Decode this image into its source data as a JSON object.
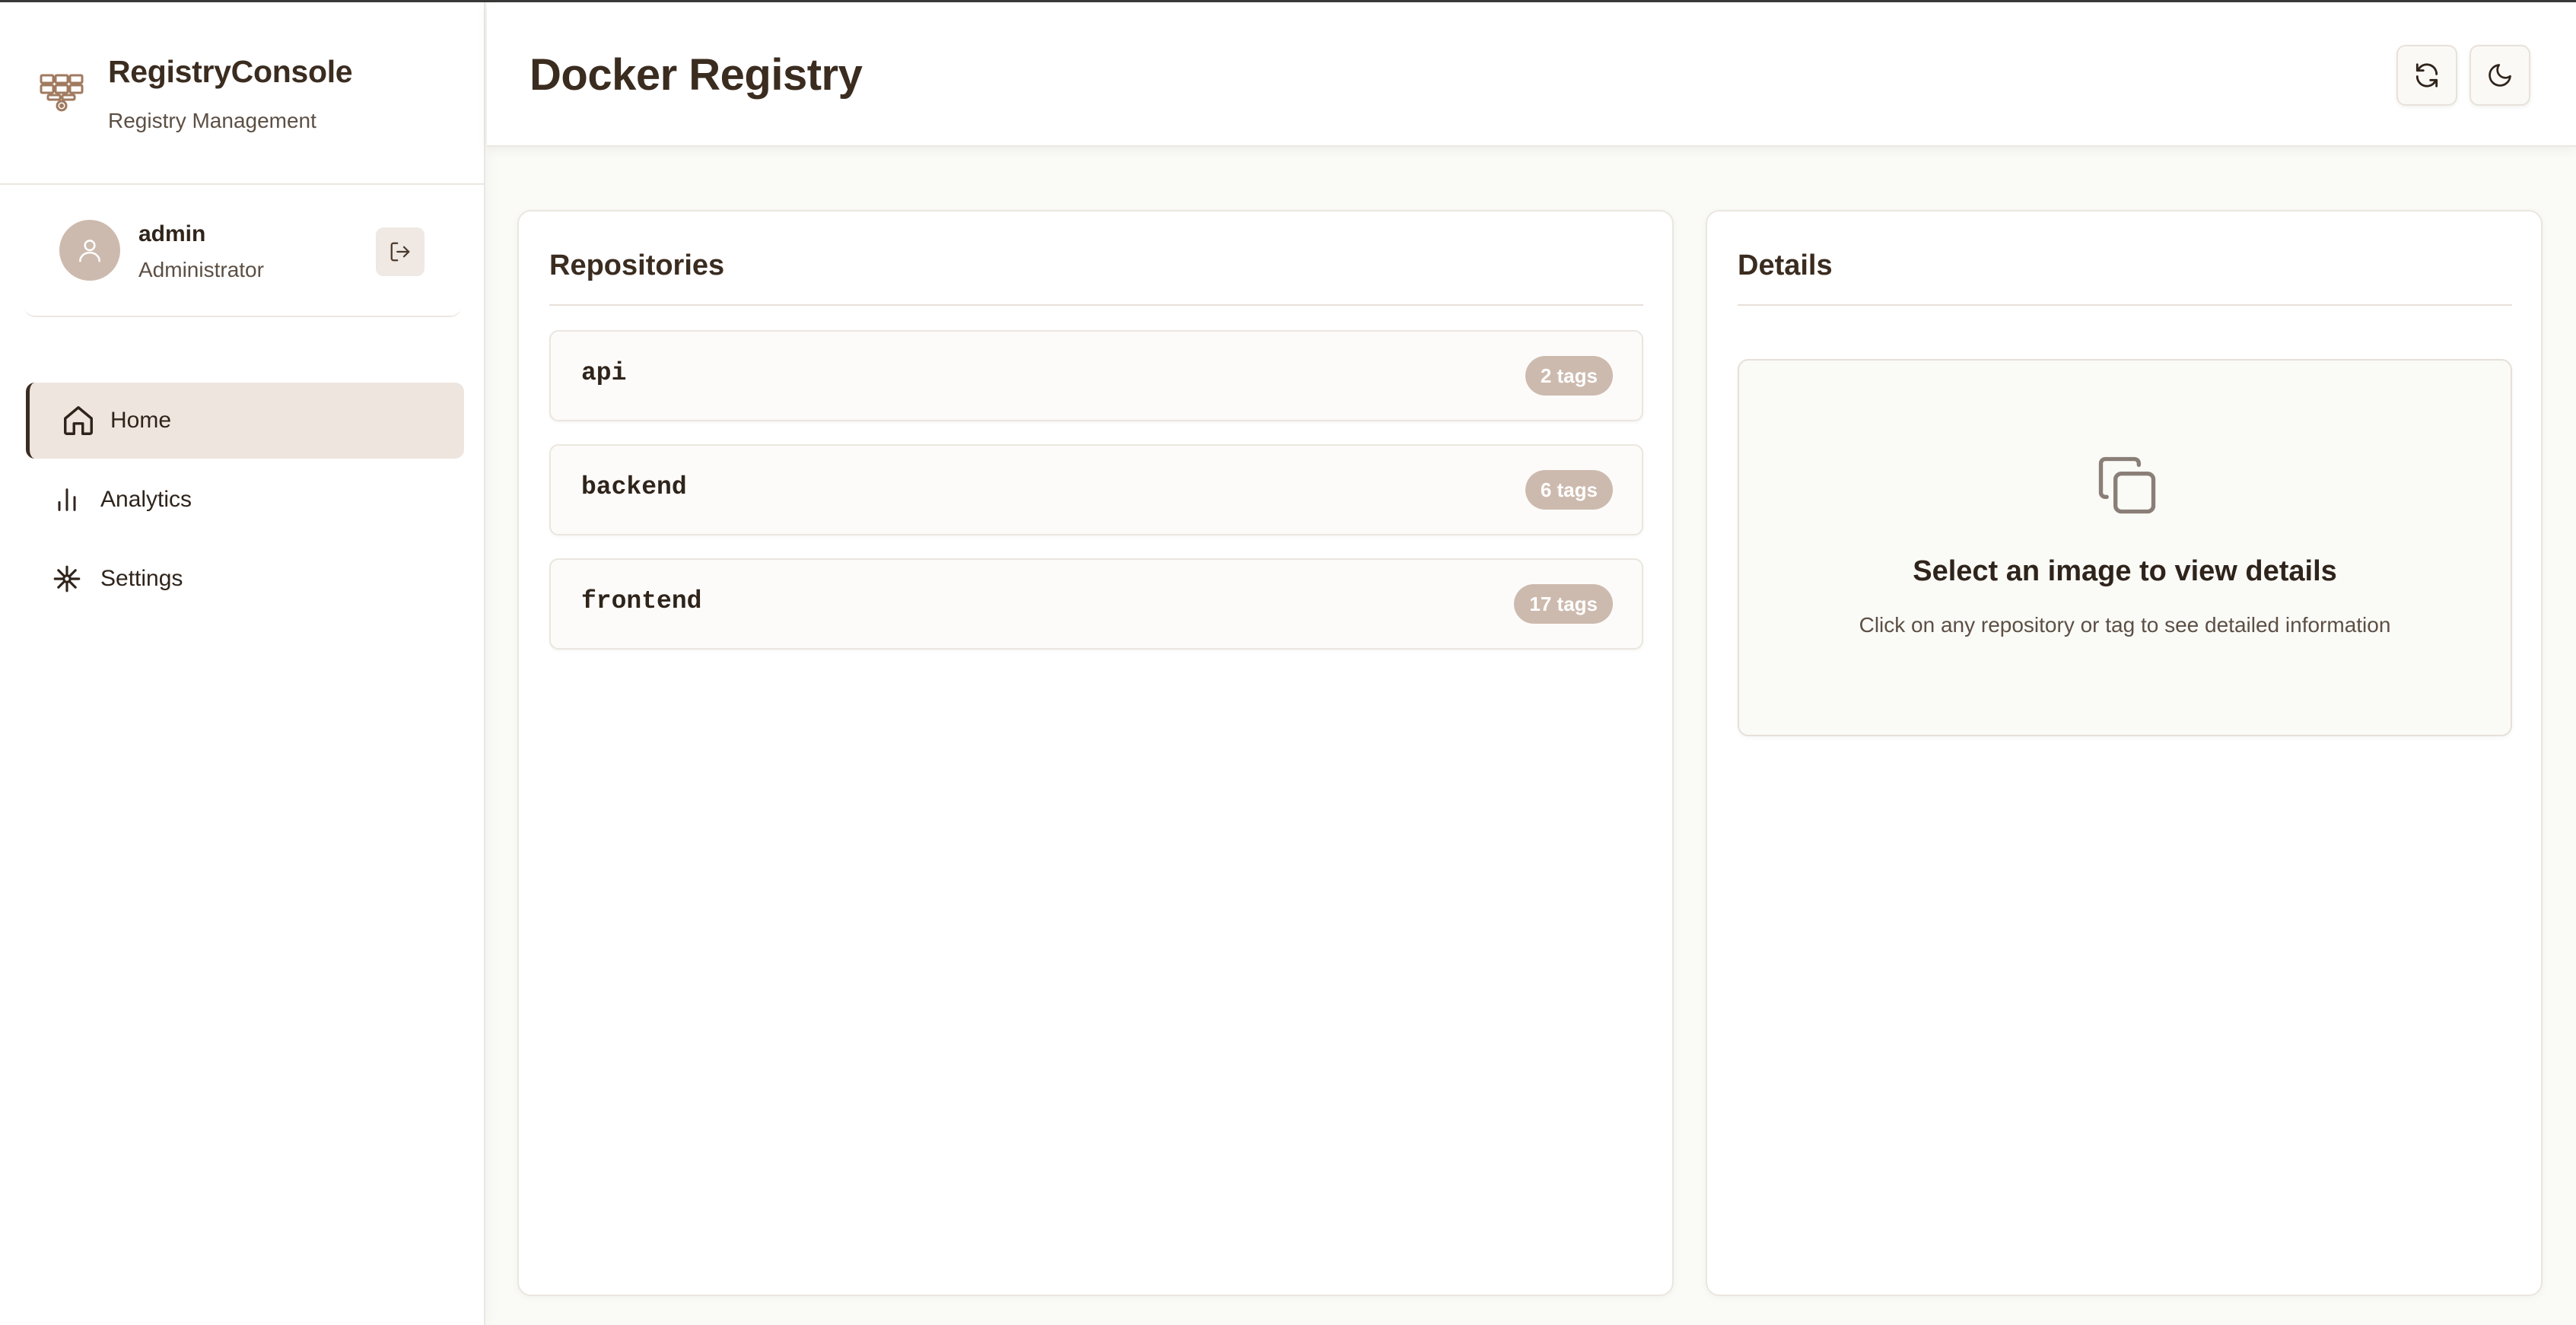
{
  "app": {
    "name": "RegistryConsole",
    "subtitle": "Registry Management"
  },
  "user": {
    "name": "admin",
    "role": "Administrator"
  },
  "nav": {
    "items": [
      {
        "label": "Home",
        "icon": "home-icon",
        "active": true
      },
      {
        "label": "Analytics",
        "icon": "bar-chart-icon",
        "active": false
      },
      {
        "label": "Settings",
        "icon": "settings-icon",
        "active": false
      }
    ]
  },
  "header": {
    "title": "Docker Registry"
  },
  "repositories": {
    "title": "Repositories",
    "items": [
      {
        "name": "api",
        "tags": "2 tags"
      },
      {
        "name": "backend",
        "tags": "6 tags"
      },
      {
        "name": "frontend",
        "tags": "17 tags"
      }
    ]
  },
  "details": {
    "title": "Details",
    "empty_title": "Select an image to view details",
    "empty_subtitle": "Click on any repository or tag to see detailed information"
  },
  "colors": {
    "accent": "#3b2c20",
    "badge": "#cdbaae",
    "nav_active_bg": "#efe5df",
    "background": "#fafaf7"
  }
}
